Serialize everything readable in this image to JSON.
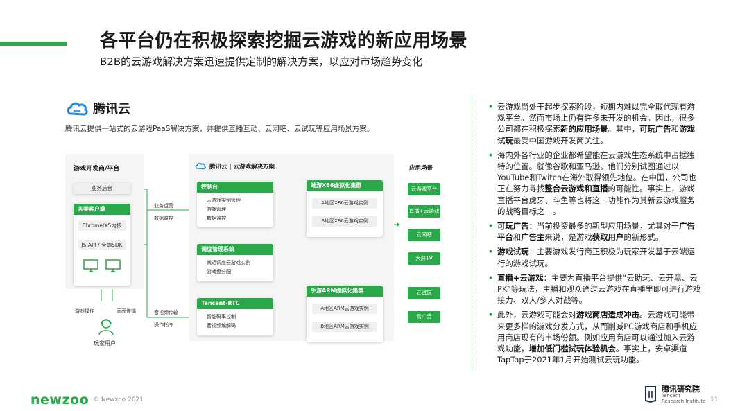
{
  "title": "各平台仍在积极探索挖掘云游戏的新应用场景",
  "subtitle": "B2B的云游戏解决方案迅速提供定制的解决方案，以应对市场趋势变化",
  "brand": {
    "name": "腾讯云",
    "description": "腾讯云提供一站式的云游戏PaaS解决方案，并提供直播互动、云网吧、云试玩等应用场景方案。"
  },
  "diagram": {
    "developer_panel": {
      "title": "游戏开发商/平台",
      "backend": "业务后台",
      "clients_title": "各类客户端",
      "clients": [
        "Chrome/X5内核",
        "JS-API / 全端SDK"
      ]
    },
    "player": {
      "label": "玩家用户",
      "op": "游戏操作",
      "video": "画面传输"
    },
    "edges": {
      "ops": "业务运营",
      "monitor": "数据监控",
      "av": "音视频传输",
      "cmd": "操作指令"
    },
    "solution": {
      "title": "腾讯云 | 云游戏解决方案",
      "console": {
        "title": "控制台",
        "items": [
          "云游戏实例管理",
          "游戏管理",
          "数据监控"
        ]
      },
      "scheduler": {
        "title": "调度管理系统",
        "items": [
          "就近调度云游戏实例",
          "游戏盘分配"
        ]
      },
      "rtc": {
        "title": "Tencent-RTC",
        "items": [
          "智能码率控制",
          "音视频编解码"
        ]
      },
      "x86": {
        "title": "端游X86虚拟化集群",
        "items": [
          "A地区X86云游戏实例",
          "B地区X86云游戏实例"
        ]
      },
      "arm": {
        "title": "手游ARM虚拟化集群",
        "items": [
          "A地区ARM云游戏实例",
          "B地区ARM云游戏实例"
        ]
      }
    },
    "apps": {
      "title": "应用场景",
      "items": [
        "云游戏平台",
        "直播+云游戏",
        "云网吧",
        "大屏TV",
        "云试玩",
        "云广告"
      ]
    }
  },
  "bullets": [
    {
      "html": "云游戏尚处于起步探索阶段，短期内难以完全取代现有游戏平台。然而市场上仍有许多未开发的机会。因此，很多公司都在积极探索<b>新的应用场景</b>。其中，<b>可玩广告</b>和<b>游戏试玩</b>最受中国游戏开发商关注。"
    },
    {
      "html": "海内外各行业的企业都希望能在云游戏生态系统中占据独特的位置。就像谷歌和亚马逊，他们分别试图通过以YouTube和Twitch在海外取得领先地位。在中国，公司也正在努力寻找<b>整合云游戏和直播</b>的可能性。事实上，游戏直播平台虎牙、斗鱼等也将这一功能作为其新云游戏服务的战略目标之一。"
    },
    {
      "html": "<b>可玩广告</b>：当前投资最多的新型应用场景，尤其对于<b>广告平台</b>和<b>广告主</b>来说，是游戏<b>获取用户</b>的新形式。"
    },
    {
      "html": "<b>游戏试玩</b>：主要游戏发行商正积极为玩家开发基于云端运行的游戏试玩。"
    },
    {
      "html": "<b>直播+云游戏</b>：主要为直播平台提供“云助玩、云开黑、云PK”等玩法，主播和观众通过云游戏在直播里即可进行游戏接力、双人/多人对战等。"
    },
    {
      "html": "此外，云游戏可能会对<b>游戏商店造成冲击</b>。云游戏可能带来更多样的游戏分发方式，从而削减PC游戏商店和手机应用商店现有的市场份额。例如应用商店可以通过加入云游戏功能，<b>增加低门槛试玩体验机会</b>。事实上，安卓渠道TapTap于2021年1月开始测试云玩功能。"
    }
  ],
  "footer": {
    "brand": "newzoo",
    "copyright": "© Newzoo 2021",
    "institute_cn": "腾讯研究院",
    "institute_en_1": "Tencent",
    "institute_en_2": "Research Institute",
    "page": "11"
  },
  "colors": {
    "accent": "#2ba84a",
    "cloud_blue": "#1e88e5"
  }
}
